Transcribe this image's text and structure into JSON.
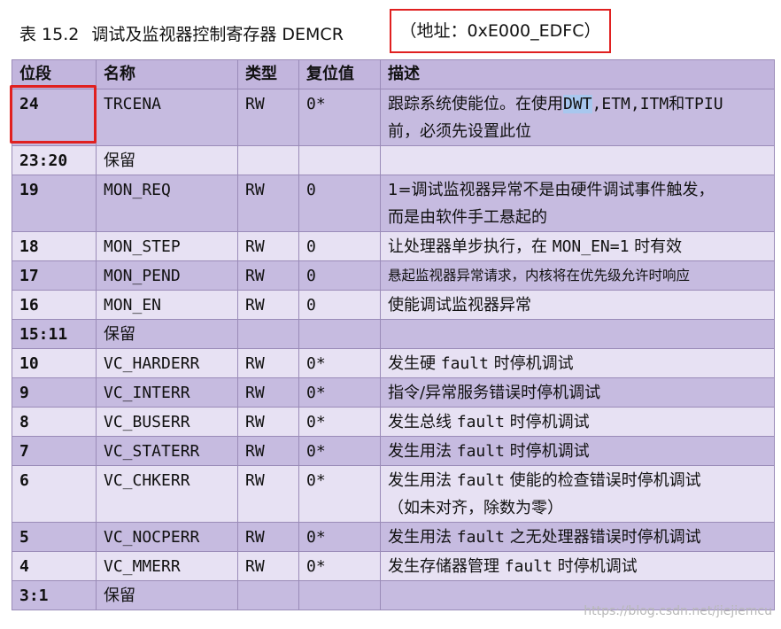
{
  "caption": {
    "number": "表 15.2",
    "title": "调试及监视器控制寄存器 DEMCR"
  },
  "address": "（地址：0xE000_EDFC）",
  "headers": {
    "bits": "位段",
    "name": "名称",
    "type": "类型",
    "reset": "复位值",
    "desc": "描述"
  },
  "rows": [
    {
      "bits": "24",
      "name": "TRCENA",
      "type": "RW",
      "reset": "0*",
      "desc": [
        "跟踪系统使能位。在使用",
        "DWT",
        ",ETM,ITM",
        "和",
        "TPIU",
        "前，必须先设置此位"
      ]
    },
    {
      "bits": "23:20",
      "name": "保留",
      "type": "",
      "reset": "",
      "desc": []
    },
    {
      "bits": "19",
      "name": "MON_REQ",
      "type": "RW",
      "reset": "0",
      "desc": [
        "1=调试监视器异常不是由硬件调试事件触发，",
        "而是由软件手工悬起的"
      ]
    },
    {
      "bits": "18",
      "name": "MON_STEP",
      "type": "RW",
      "reset": "0",
      "desc": [
        "让处理器单步执行，在 ",
        "MON_EN=1",
        " 时有效"
      ]
    },
    {
      "bits": "17",
      "name": "MON_PEND",
      "type": "RW",
      "reset": "0",
      "desc": [
        "悬起监视器异常请求，内核将在优先级允许时响应"
      ]
    },
    {
      "bits": "16",
      "name": "MON_EN",
      "type": "RW",
      "reset": "0",
      "desc": [
        "使能调试监视器异常"
      ]
    },
    {
      "bits": "15:11",
      "name": "保留",
      "type": "",
      "reset": "",
      "desc": []
    },
    {
      "bits": "10",
      "name": "VC_HARDERR",
      "type": "RW",
      "reset": "0*",
      "desc": [
        "发生硬 ",
        "fault",
        " 时停机调试"
      ]
    },
    {
      "bits": "9",
      "name": "VC_INTERR",
      "type": "RW",
      "reset": "0*",
      "desc": [
        "指令/异常服务错误时停机调试"
      ]
    },
    {
      "bits": "8",
      "name": "VC_BUSERR",
      "type": "RW",
      "reset": "0*",
      "desc": [
        "发生总线 ",
        "fault",
        " 时停机调试"
      ]
    },
    {
      "bits": "7",
      "name": "VC_STATERR",
      "type": "RW",
      "reset": "0*",
      "desc": [
        "发生用法 ",
        "fault",
        " 时停机调试"
      ]
    },
    {
      "bits": "6",
      "name": "VC_CHKERR",
      "type": "RW",
      "reset": "0*",
      "desc": [
        "发生用法 ",
        "fault",
        " 使能的检查错误时停机调试",
        "（如未对齐，除数为零）"
      ]
    },
    {
      "bits": "5",
      "name": "VC_NOCPERR",
      "type": "RW",
      "reset": "0*",
      "desc": [
        "发生用法 ",
        "fault",
        " 之无处理器错误时停机调试"
      ]
    },
    {
      "bits": "4",
      "name": "VC_MMERR",
      "type": "RW",
      "reset": "0*",
      "desc": [
        "发生存储器管理 ",
        "fault",
        " 时停机调试"
      ]
    },
    {
      "bits": "3:1",
      "name": "保留",
      "type": "",
      "reset": "",
      "desc": []
    }
  ],
  "watermark": "https://blog.csdn.net/jiejiemcu",
  "colors": {
    "header_bg": "#c2b5dd",
    "row_dark": "#c6bbe0",
    "row_light": "#e7e1f3",
    "highlight_border": "#e02020"
  }
}
